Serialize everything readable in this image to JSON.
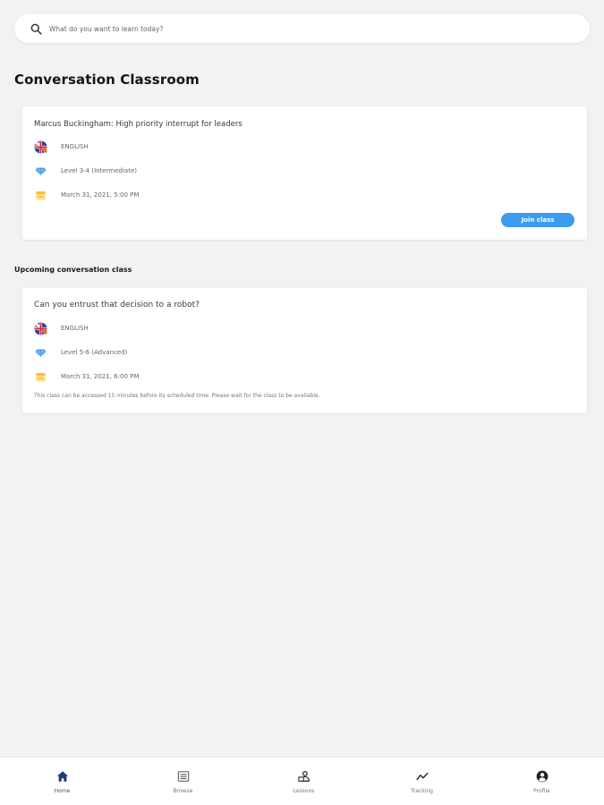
{
  "search": {
    "placeholder": "What do you want to learn today?"
  },
  "page_title": "Conversation Classroom",
  "live_class": {
    "title": "Marcus Buckingham: High priority interrupt for leaders",
    "language": "ENGLISH",
    "level": "Level 3-4 (Intermediate)",
    "datetime": "March 31, 2021, 5:00 PM",
    "join_label": "Join class"
  },
  "upcoming_heading": "Upcoming conversation class",
  "upcoming_class": {
    "title": "Can you entrust that decision to a robot?",
    "language": "ENGLISH",
    "level": "Level 5-6 (Advanced)",
    "datetime": "March 31, 2021, 6:00 PM",
    "notice": "This class can be accessed 15 minutes before its scheduled time. Please wait for the class to be available."
  },
  "nav": {
    "items": [
      {
        "label": "Home",
        "icon": "home-icon",
        "active": true
      },
      {
        "label": "Browse",
        "icon": "list-icon",
        "active": false
      },
      {
        "label": "Lessons",
        "icon": "lessons-icon",
        "active": false
      },
      {
        "label": "Tracking",
        "icon": "trend-icon",
        "active": false
      },
      {
        "label": "Profile",
        "icon": "profile-icon",
        "active": false
      }
    ]
  },
  "colors": {
    "accent": "#3d9bf0",
    "nav_active": "#1f3a7a",
    "background": "#f1f2f1"
  }
}
